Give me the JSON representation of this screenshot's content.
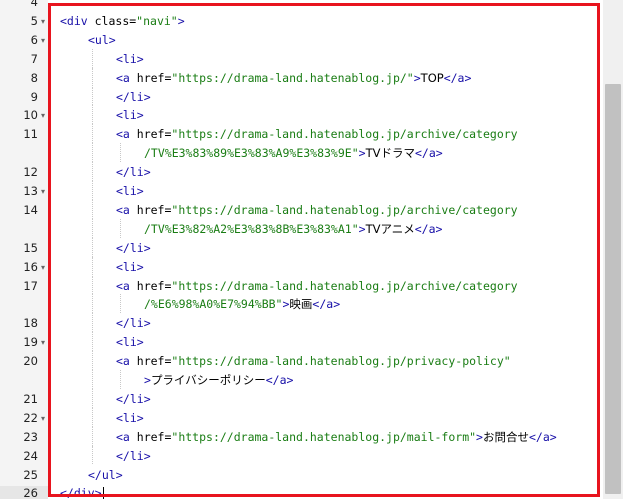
{
  "editor": {
    "colors": {
      "tag": "#170fa8",
      "string": "#1a7d14",
      "highlight": "#e8141e"
    },
    "active_line": "26",
    "lines": [
      {
        "num": "4",
        "fold": false,
        "indent": 0,
        "segs": []
      },
      {
        "num": "5",
        "fold": true,
        "indent": 0,
        "segs": [
          {
            "c": "t",
            "v": "<div"
          },
          {
            "c": "a",
            "v": " class="
          },
          {
            "c": "s",
            "v": "\"navi\""
          },
          {
            "c": "t",
            "v": ">"
          }
        ]
      },
      {
        "num": "6",
        "fold": true,
        "indent": 1,
        "segs": [
          {
            "c": "t",
            "v": "<ul>"
          }
        ]
      },
      {
        "num": "7",
        "fold": false,
        "indent": 2,
        "segs": [
          {
            "c": "t",
            "v": "<li>"
          }
        ]
      },
      {
        "num": "8",
        "fold": false,
        "indent": 2,
        "segs": [
          {
            "c": "t",
            "v": "<a"
          },
          {
            "c": "a",
            "v": " href="
          },
          {
            "c": "s",
            "v": "\"https://drama-land.hatenablog.jp/\""
          },
          {
            "c": "t",
            "v": ">"
          },
          {
            "c": "x",
            "v": "TOP"
          },
          {
            "c": "t",
            "v": "</a>"
          }
        ]
      },
      {
        "num": "9",
        "fold": false,
        "indent": 2,
        "segs": [
          {
            "c": "t",
            "v": "</li>"
          }
        ]
      },
      {
        "num": "10",
        "fold": true,
        "indent": 2,
        "segs": [
          {
            "c": "t",
            "v": "<li>"
          }
        ]
      },
      {
        "num": "11",
        "fold": false,
        "indent": 2,
        "segs": [
          {
            "c": "t",
            "v": "<a"
          },
          {
            "c": "a",
            "v": " href="
          },
          {
            "c": "s",
            "v": "\"https://drama-land.hatenablog.jp/archive/category"
          }
        ]
      },
      {
        "num": "",
        "fold": false,
        "indent": 3,
        "segs": [
          {
            "c": "s",
            "v": "/TV%E3%83%89%E3%83%A9%E3%83%9E\""
          },
          {
            "c": "t",
            "v": ">"
          },
          {
            "c": "x",
            "v": "TVドラマ"
          },
          {
            "c": "t",
            "v": "</a>"
          }
        ]
      },
      {
        "num": "12",
        "fold": false,
        "indent": 2,
        "segs": [
          {
            "c": "t",
            "v": "</li>"
          }
        ]
      },
      {
        "num": "13",
        "fold": true,
        "indent": 2,
        "segs": [
          {
            "c": "t",
            "v": "<li>"
          }
        ]
      },
      {
        "num": "14",
        "fold": false,
        "indent": 2,
        "segs": [
          {
            "c": "t",
            "v": "<a"
          },
          {
            "c": "a",
            "v": " href="
          },
          {
            "c": "s",
            "v": "\"https://drama-land.hatenablog.jp/archive/category"
          }
        ]
      },
      {
        "num": "",
        "fold": false,
        "indent": 3,
        "segs": [
          {
            "c": "s",
            "v": "/TV%E3%82%A2%E3%83%8B%E3%83%A1\""
          },
          {
            "c": "t",
            "v": ">"
          },
          {
            "c": "x",
            "v": "TVアニメ"
          },
          {
            "c": "t",
            "v": "</a>"
          }
        ]
      },
      {
        "num": "15",
        "fold": false,
        "indent": 2,
        "segs": [
          {
            "c": "t",
            "v": "</li>"
          }
        ]
      },
      {
        "num": "16",
        "fold": true,
        "indent": 2,
        "segs": [
          {
            "c": "t",
            "v": "<li>"
          }
        ]
      },
      {
        "num": "17",
        "fold": false,
        "indent": 2,
        "segs": [
          {
            "c": "t",
            "v": "<a"
          },
          {
            "c": "a",
            "v": " href="
          },
          {
            "c": "s",
            "v": "\"https://drama-land.hatenablog.jp/archive/category"
          }
        ]
      },
      {
        "num": "",
        "fold": false,
        "indent": 3,
        "segs": [
          {
            "c": "s",
            "v": "/%E6%98%A0%E7%94%BB\""
          },
          {
            "c": "t",
            "v": ">"
          },
          {
            "c": "x",
            "v": "映画"
          },
          {
            "c": "t",
            "v": "</a>"
          }
        ]
      },
      {
        "num": "18",
        "fold": false,
        "indent": 2,
        "segs": [
          {
            "c": "t",
            "v": "</li>"
          }
        ]
      },
      {
        "num": "19",
        "fold": true,
        "indent": 2,
        "segs": [
          {
            "c": "t",
            "v": "<li>"
          }
        ]
      },
      {
        "num": "20",
        "fold": false,
        "indent": 2,
        "segs": [
          {
            "c": "t",
            "v": "<a"
          },
          {
            "c": "a",
            "v": " href="
          },
          {
            "c": "s",
            "v": "\"https://drama-land.hatenablog.jp/privacy-policy\""
          }
        ]
      },
      {
        "num": "",
        "fold": false,
        "indent": 3,
        "segs": [
          {
            "c": "t",
            "v": ">"
          },
          {
            "c": "x",
            "v": "プライバシーポリシー"
          },
          {
            "c": "t",
            "v": "</a>"
          }
        ]
      },
      {
        "num": "21",
        "fold": false,
        "indent": 2,
        "segs": [
          {
            "c": "t",
            "v": "</li>"
          }
        ]
      },
      {
        "num": "22",
        "fold": true,
        "indent": 2,
        "segs": [
          {
            "c": "t",
            "v": "<li>"
          }
        ]
      },
      {
        "num": "23",
        "fold": false,
        "indent": 2,
        "segs": [
          {
            "c": "t",
            "v": "<a"
          },
          {
            "c": "a",
            "v": " href="
          },
          {
            "c": "s",
            "v": "\"https://drama-land.hatenablog.jp/mail-form\""
          },
          {
            "c": "t",
            "v": ">"
          },
          {
            "c": "x",
            "v": "お問合せ"
          },
          {
            "c": "t",
            "v": "</a>"
          }
        ]
      },
      {
        "num": "24",
        "fold": false,
        "indent": 2,
        "segs": [
          {
            "c": "t",
            "v": "</li>"
          }
        ]
      },
      {
        "num": "25",
        "fold": false,
        "indent": 1,
        "segs": [
          {
            "c": "t",
            "v": "</ul>"
          }
        ]
      },
      {
        "num": "26",
        "fold": false,
        "indent": 0,
        "segs": [
          {
            "c": "t",
            "v": "</div>"
          }
        ]
      }
    ]
  }
}
